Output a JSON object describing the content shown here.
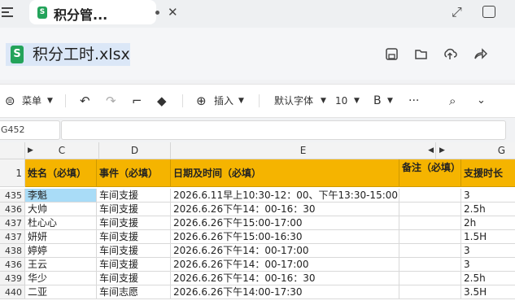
{
  "tab": {
    "title": "积分管...",
    "sheet_badge": "S"
  },
  "file": {
    "title": "积分工时.xlsx",
    "sheet_badge": "S"
  },
  "toolbar": {
    "menu_label": "菜单",
    "insert_label": "插入",
    "font_name": "默认字体",
    "font_size": "10",
    "bold_label": "B",
    "more_label": "···"
  },
  "formula_bar": {
    "cell_ref": "G452",
    "formula": ""
  },
  "columns": [
    "C",
    "D",
    "E",
    "G"
  ],
  "header_row": {
    "number": "1",
    "cells": [
      "姓名（必填）",
      "事件（必填）",
      "日期及时间（必填）",
      "备注（必填）",
      "支援时长"
    ]
  },
  "rows": [
    {
      "num": "435",
      "name": "李魁",
      "event": "车间支援",
      "datetime": "2026.6.11早上10:30-12：00、下午13:30-15:00",
      "note": "",
      "duration": "3"
    },
    {
      "num": "436",
      "name": "大帅",
      "event": "车间支援",
      "datetime": "2026.6.26下午14：00-16：30",
      "note": "",
      "duration": "2.5h"
    },
    {
      "num": "437",
      "name": "杜心心",
      "event": "车间支援",
      "datetime": "2026.6.26下午15:00-17:00",
      "note": "",
      "duration": "2h"
    },
    {
      "num": "437",
      "name": "妍妍",
      "event": "车间支援",
      "datetime": "2026.6.26下午15:00-16:30",
      "note": "",
      "duration": "1.5H"
    },
    {
      "num": "438",
      "name": "婷婷",
      "event": "车间支援",
      "datetime": "2026.6.26下午14：00-17:00",
      "note": "",
      "duration": "3"
    },
    {
      "num": "436",
      "name": "王云",
      "event": "车间支援",
      "datetime": "2026.6.26下午14：00-17:00",
      "note": "",
      "duration": "3"
    },
    {
      "num": "439",
      "name": "华少",
      "event": "车间支援",
      "datetime": "2026.6.26下午14：00-16：30",
      "note": "",
      "duration": "2.5h"
    },
    {
      "num": "440",
      "name": "二亚",
      "event": "车间志愿",
      "datetime": "2026.6.26下午14:00-17:30",
      "note": "",
      "duration": "3.5H"
    }
  ],
  "colors": {
    "header_fill": "#f5b400",
    "selected_cell": "#a9dcf7",
    "sheet_icon": "#23a35a"
  }
}
